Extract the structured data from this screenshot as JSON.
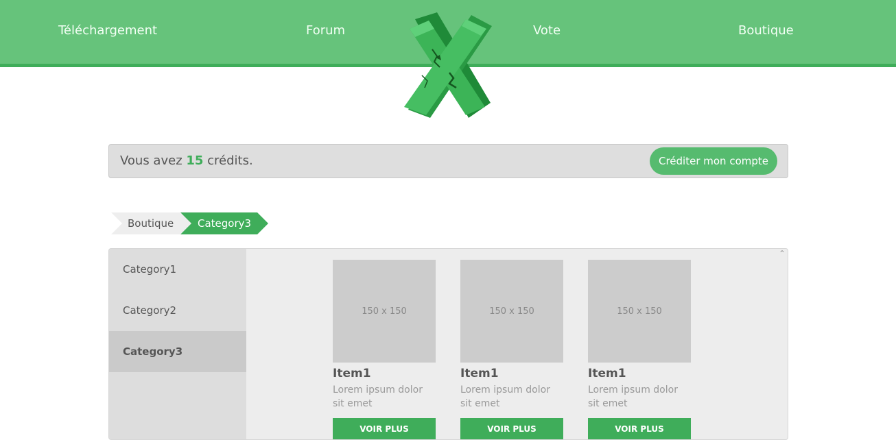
{
  "nav": {
    "items": [
      "Téléchargement",
      "Forum",
      "Vote",
      "Boutique"
    ]
  },
  "logo": {
    "icon": "green-x-logo-icon",
    "color": "#3fad5a"
  },
  "credits": {
    "prefix": "Vous avez ",
    "amount": "15",
    "suffix": " crédits.",
    "button": "Créditer mon compte"
  },
  "breadcrumb": [
    "Boutique",
    "Category3"
  ],
  "sidebar": {
    "items": [
      "Category1",
      "Category2",
      "Category3"
    ],
    "active": "Category3"
  },
  "items": [
    {
      "thumb": "150 x 150",
      "title": "Item1",
      "desc": "Lorem ipsum dolor sit emet",
      "button": "VOIR PLUS"
    },
    {
      "thumb": "150 x 150",
      "title": "Item1",
      "desc": "Lorem ipsum dolor sit emet",
      "button": "VOIR PLUS"
    },
    {
      "thumb": "150 x 150",
      "title": "Item1",
      "desc": "Lorem ipsum dolor sit emet",
      "button": "VOIR PLUS"
    }
  ],
  "colors": {
    "nav_bg": "#66c37b",
    "accent": "#3fad5a",
    "panel_bg": "#ededed"
  }
}
